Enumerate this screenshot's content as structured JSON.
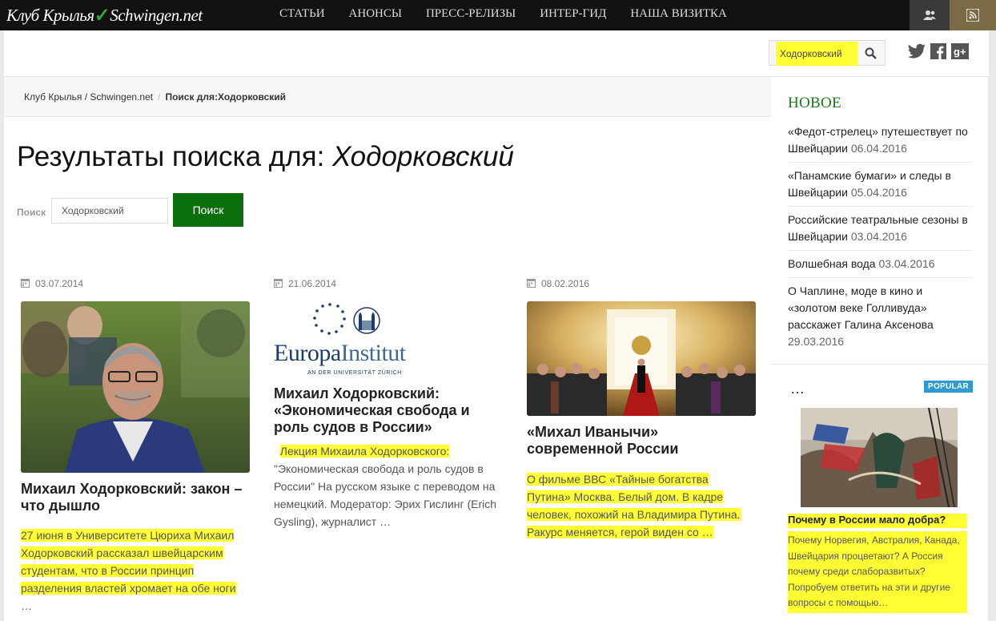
{
  "topnav": {
    "logo_part1": "Клуб Крылья",
    "logo_part2": "Schwingen.net",
    "menu": [
      "СТАТЬИ",
      "АНОНСЫ",
      "ПРЕСС-РЕЛИЗЫ",
      "ИНТЕР-ГИД",
      "НАША ВИЗИТКА"
    ]
  },
  "header": {
    "search_value": "Ходорковский"
  },
  "breadcrumb": {
    "home": "Клуб Крылья / Schwingen.net",
    "current": "Поиск для:Ходорковский"
  },
  "page": {
    "title_prefix": "Результаты поиска для:",
    "title_query": "Ходорковский"
  },
  "search_form": {
    "label": "Поиск",
    "value": "Ходорковский",
    "button": "Поиск"
  },
  "results": [
    {
      "date": "03.07.2014",
      "title": "Михаил Ходорковский: закон – что дышло",
      "excerpt": "27 июня в Университете Цюриха Михаил Ходорковский рассказал швейцарским студентам, что в России принцип разделения властей хромает на обе ноги",
      "more": "…"
    },
    {
      "date": "21.06.2014",
      "logo_word1": "Europa",
      "logo_word2": "Institut",
      "logo_sub": "AN DER UNIVERSITÄT ZÜRICH",
      "title": "Михаил Ходорковский: «Экономическая свобода и роль судов в России»",
      "excerpt_hl": "Лекция Михаила Ходорковского:",
      "excerpt": "\"Экономическая свобода и роль судов в России\" На русском языке с переводом на немецкий. Модератор: Эрих Гислинг (Erich Gysling), журналист …"
    },
    {
      "date": "08.02.2016",
      "title": "«Михал Иванычи» современной России",
      "excerpt": "О фильме ВВС «Тайные богатства Путина» Москва. Белый дом. В кадре человек, похожий на Владимира Путина. Ракурс меняется, герой виден со …"
    }
  ],
  "sidebar_new": {
    "title": "НОВОЕ",
    "items": [
      {
        "text": "«Федот-стрелец» путешествует по Швейцарии",
        "date": "06.04.2016"
      },
      {
        "text": "«Панамские бумаги» и следы в Швейцарии",
        "date": "05.04.2016"
      },
      {
        "text": "Российские театральные сезоны в Швейцарии",
        "date": "03.04.2016"
      },
      {
        "text": "Волшебная вода",
        "date": "03.04.2016"
      },
      {
        "text": "О Чаплине, моде в кино и «золотом веке Голливуда» расскажет Галина Аксенова",
        "date": "29.03.2016"
      }
    ]
  },
  "sidebar_popular": {
    "heading": "…",
    "badge": "POPULAR",
    "title": "Почему в России мало добра?",
    "text": "Почему Норвегия, Австралия, Канада, Швейцария процветают? А Россия почему среди слаборазвитых? Попробуем ответить на эти и другие вопросы с помощью…"
  },
  "colors": {
    "nav_bg": "#111111",
    "accent_green": "#0a6e0a",
    "sidebar_title": "#1a7a1a",
    "highlight": "#ffff33",
    "badge": "#2d9ad0"
  },
  "icons": [
    "user-icon",
    "rss-icon",
    "search-icon",
    "twitter-icon",
    "facebook-icon",
    "google-plus-icon",
    "calendar-icon"
  ]
}
